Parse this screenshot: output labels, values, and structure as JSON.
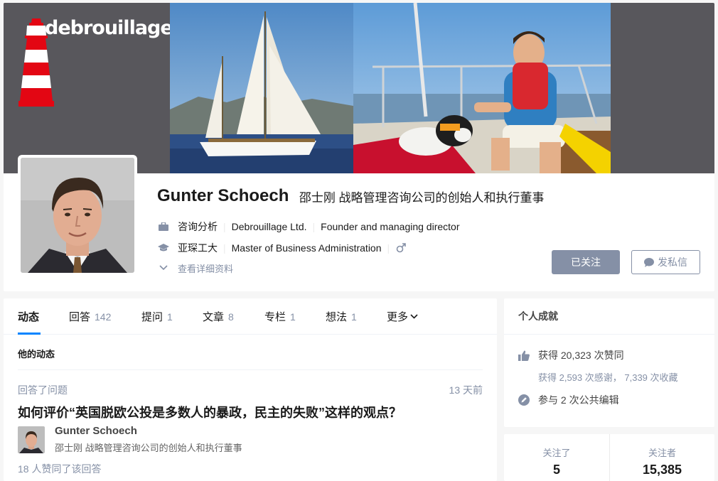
{
  "profile": {
    "cover_logo": "debrouillage",
    "name": "Gunter Schoech",
    "headline": "邵士刚 战略管理咨询公司的创始人和执行董事",
    "work": {
      "industry": "咨询分析",
      "company": "Debrouillage Ltd.",
      "position": "Founder and managing director"
    },
    "education": {
      "school": "亚琛工大",
      "major": "Master of Business Administration"
    },
    "more_label": "查看详细资料",
    "follow_label": "已关注",
    "message_label": "发私信"
  },
  "tabs": [
    {
      "label": "动态",
      "count": ""
    },
    {
      "label": "回答",
      "count": "142"
    },
    {
      "label": "提问",
      "count": "1"
    },
    {
      "label": "文章",
      "count": "8"
    },
    {
      "label": "专栏",
      "count": "1"
    },
    {
      "label": "想法",
      "count": "1"
    },
    {
      "label": "更多",
      "count": ""
    }
  ],
  "feed": {
    "section_title": "他的动态",
    "item": {
      "meta": "回答了问题",
      "time": "13 天前",
      "title": "如何评价“英国脱欧公投是多数人的暴政，民主的失败”这样的观点？",
      "author": "Gunter Schoech",
      "author_headline": "邵士刚 战略管理咨询公司的创始人和执行董事",
      "votes": "18 人赞同了该回答"
    }
  },
  "achievements": {
    "title": "个人成就",
    "votes": "获得 20,323 次赞同",
    "thanks": "获得 2,593 次感谢， 7,339 次收藏",
    "edits": "参与 2 次公共编辑"
  },
  "follow_stats": {
    "following_label": "关注了",
    "following_count": "5",
    "followers_label": "关注者",
    "followers_count": "15,385"
  },
  "colors": {
    "accent": "#0084ff",
    "muted": "#8590a6",
    "cover_bg": "#58575c"
  }
}
